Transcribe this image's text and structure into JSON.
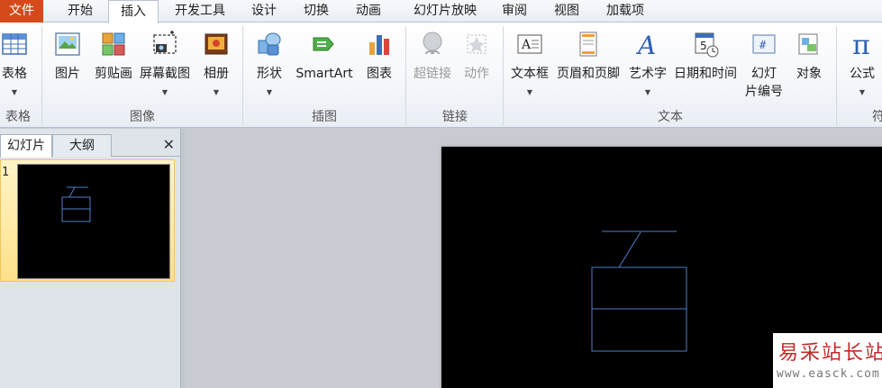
{
  "tabs": {
    "file": "文件",
    "home": "开始",
    "insert": "插入",
    "developer": "开发工具",
    "design": "设计",
    "transitions": "切换",
    "animations": "动画",
    "slideshow": "幻灯片放映",
    "review": "审阅",
    "view": "视图",
    "addins": "加载项"
  },
  "ribbon": {
    "tables": {
      "label": "表格",
      "table": "表格"
    },
    "images": {
      "label": "图像",
      "picture": "图片",
      "clipart": "剪贴画",
      "screenshot": "屏幕截图",
      "album": "相册"
    },
    "illustrations": {
      "label": "插图",
      "shapes": "形状",
      "smartart": "SmartArt",
      "chart": "图表"
    },
    "links": {
      "label": "链接",
      "hyperlink": "超链接",
      "action": "动作"
    },
    "text": {
      "label": "文本",
      "textbox": "文本框",
      "header_footer": "页眉和页脚",
      "wordart": "艺术字",
      "datetime": "日期和时间",
      "slide_number_1": "幻灯",
      "slide_number_2": "片编号",
      "object": "对象"
    },
    "symbols": {
      "label": "符",
      "equation": "公式"
    }
  },
  "panel": {
    "tab_slides": "幻灯片",
    "tab_outline": "大纲",
    "close": "✕",
    "slide_number": "1"
  },
  "colors": {
    "file_tab": "#d44a1a",
    "slide_bg": "#000000",
    "shape_stroke": "#4f7ec9",
    "selection": "#ffe08a"
  },
  "watermark": {
    "title": "易采站长站",
    "url": "www.easck.com"
  }
}
